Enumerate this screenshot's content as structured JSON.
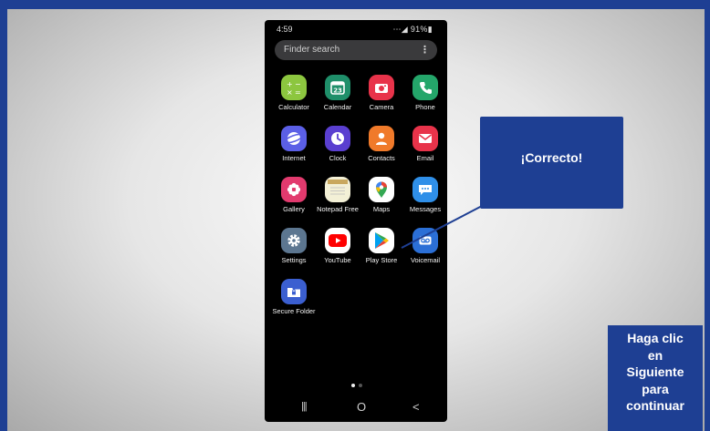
{
  "status_bar": {
    "time": "4:59",
    "right": "⋯◢ 91%▮"
  },
  "search": {
    "placeholder": "Finder search",
    "menu_glyph": "⋮"
  },
  "apps": [
    {
      "label": "Calculator",
      "icon": "calculator-icon",
      "color": "#8cc63f"
    },
    {
      "label": "Calendar",
      "icon": "calendar-icon",
      "color": "#1f8f6a",
      "glyph": "23"
    },
    {
      "label": "Camera",
      "icon": "camera-icon",
      "color": "#e8334a"
    },
    {
      "label": "Phone",
      "icon": "phone-icon",
      "color": "#24a66a"
    },
    {
      "label": "Internet",
      "icon": "internet-icon",
      "color": "#5b5fe6"
    },
    {
      "label": "Clock",
      "icon": "clock-icon",
      "color": "#5a3fd0"
    },
    {
      "label": "Contacts",
      "icon": "contacts-icon",
      "color": "#f07a2a"
    },
    {
      "label": "Email",
      "icon": "email-icon",
      "color": "#e8334a"
    },
    {
      "label": "Gallery",
      "icon": "gallery-icon",
      "color": "#e23a6e"
    },
    {
      "label": "Notepad Free",
      "icon": "notepad-icon",
      "color": "#f3f0d6"
    },
    {
      "label": "Maps",
      "icon": "maps-icon",
      "color": "#ffffff"
    },
    {
      "label": "Messages",
      "icon": "messages-icon",
      "color": "#2f8fe8"
    },
    {
      "label": "Settings",
      "icon": "settings-icon",
      "color": "#5c7690"
    },
    {
      "label": "YouTube",
      "icon": "youtube-icon",
      "color": "#ffffff"
    },
    {
      "label": "Play Store",
      "icon": "play-store-icon",
      "color": "#ffffff"
    },
    {
      "label": "Voicemail",
      "icon": "voicemail-icon",
      "color": "#2b6fd6"
    },
    {
      "label": "Secure Folder",
      "icon": "secure-folder-icon",
      "color": "#3b5fd0"
    }
  ],
  "nav_bar": {
    "recents": "|||",
    "home": "O",
    "back": "<"
  },
  "callout": {
    "text": "¡Correcto!"
  },
  "next_prompt": {
    "lines": [
      "Haga clic",
      "en",
      "Siguiente",
      "para",
      "continuar"
    ]
  },
  "colors": {
    "brand_blue": "#1e3f93",
    "phone_bg": "#000000"
  }
}
